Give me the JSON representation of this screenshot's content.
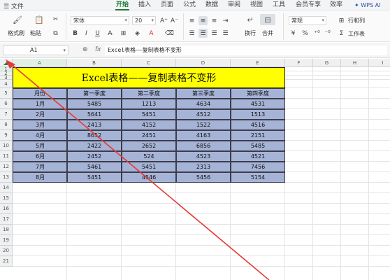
{
  "menubar": {
    "toggle": "☰ 文件",
    "items": [
      "开始",
      "插入",
      "页面",
      "公式",
      "数据",
      "审阅",
      "视图",
      "工具",
      "会员专享",
      "效率"
    ],
    "active_index": 0,
    "wps_ai": "✦ WPS AI"
  },
  "ribbon": {
    "format_painter": "格式刷",
    "paste": "粘贴",
    "font_name": "宋体",
    "font_size": "20",
    "wrap_text": "换行",
    "merge": "合并",
    "number_format": "常规",
    "rows_cols": "行和列",
    "worksheet": "工作表",
    "bold": "B",
    "italic": "I",
    "underline": "U",
    "font_color_label": "A"
  },
  "formula_bar": {
    "cell_ref": "A1",
    "fx": "fx",
    "content": "Excel表格——复制表格不变形"
  },
  "sheet": {
    "columns": [
      "A",
      "B",
      "C",
      "D",
      "E",
      "F",
      "G",
      "H",
      "I"
    ],
    "rows": [
      "1",
      "2",
      "3",
      "4",
      "5",
      "6",
      "7",
      "8",
      "9",
      "10",
      "11",
      "12",
      "13",
      "14",
      "15",
      "16",
      "17",
      "18",
      "19",
      "20",
      "21"
    ],
    "title": "Excel表格——复制表格不变形",
    "headers": [
      "月份",
      "第一季度",
      "第二季度",
      "第三季度",
      "第四季度"
    ],
    "data": [
      [
        "1月",
        "5485",
        "1213",
        "4634",
        "4531"
      ],
      [
        "2月",
        "5641",
        "5451",
        "4512",
        "1513"
      ],
      [
        "3月",
        "2413",
        "4152",
        "1522",
        "4516"
      ],
      [
        "4月",
        "8652",
        "2451",
        "4163",
        "2151"
      ],
      [
        "5月",
        "2422",
        "2652",
        "6856",
        "5485"
      ],
      [
        "6月",
        "2452",
        "524",
        "4523",
        "4521"
      ],
      [
        "7月",
        "5461",
        "5451",
        "2313",
        "7456"
      ],
      [
        "8月",
        "5451",
        "4546",
        "5456",
        "5154"
      ]
    ]
  },
  "colors": {
    "title_fill": "#ffff00",
    "data_fill": "#a5b3d6",
    "accent": "#1f7a3a",
    "annotation": "#e53935"
  }
}
